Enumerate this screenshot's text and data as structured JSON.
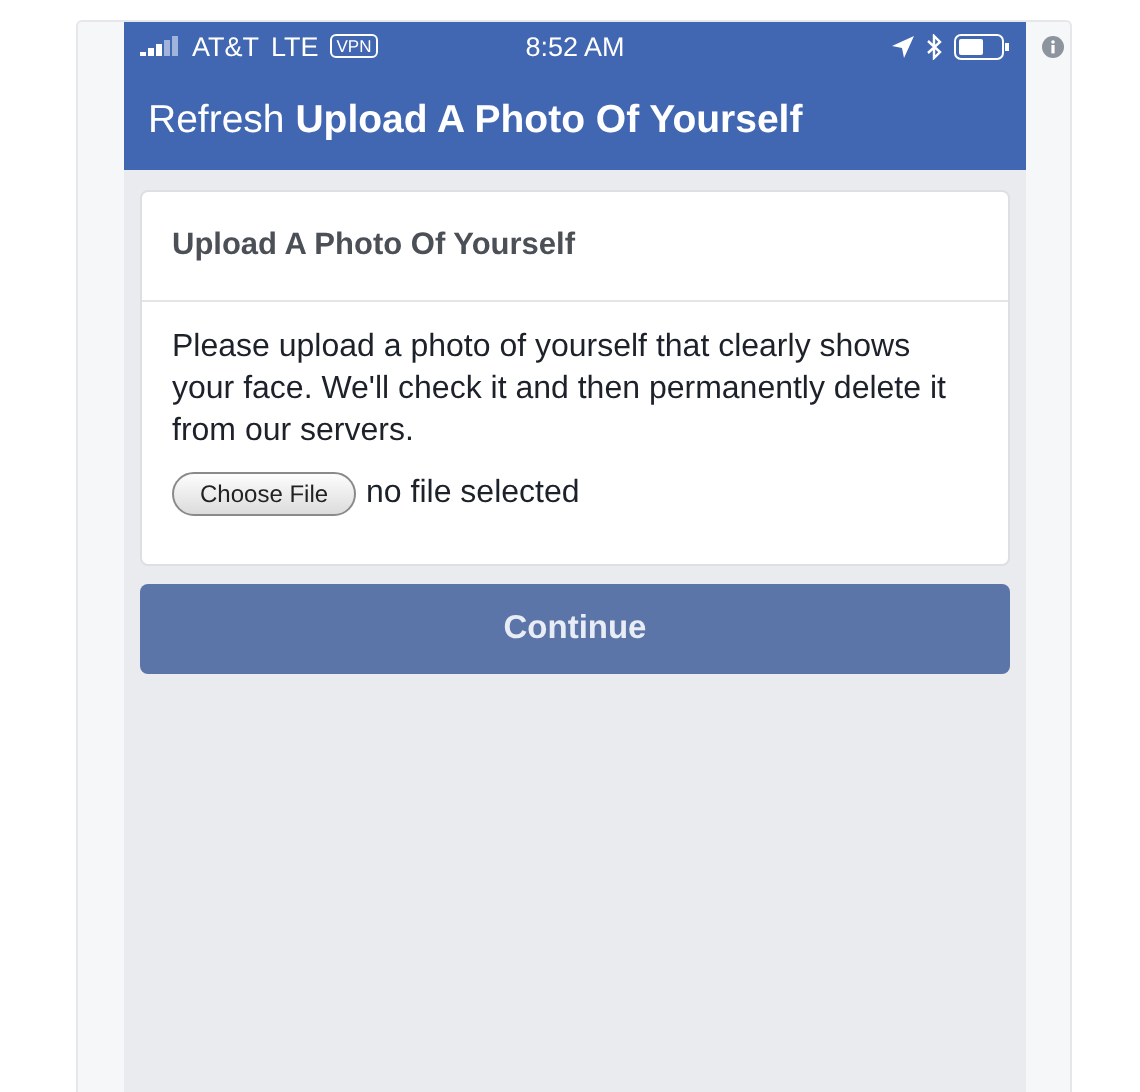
{
  "status_bar": {
    "carrier": "AT&T",
    "network": "LTE",
    "vpn": "VPN",
    "time": "8:52 AM"
  },
  "header": {
    "prefix": "Refresh",
    "title": "Upload A Photo Of Yourself"
  },
  "card": {
    "title": "Upload A Photo Of Yourself",
    "message": "Please upload a photo of yourself that clearly shows your face. We'll check it and then permanently delete it from our servers.",
    "file_button": "Choose File",
    "file_status": "no file selected"
  },
  "continue_button": "Continue"
}
